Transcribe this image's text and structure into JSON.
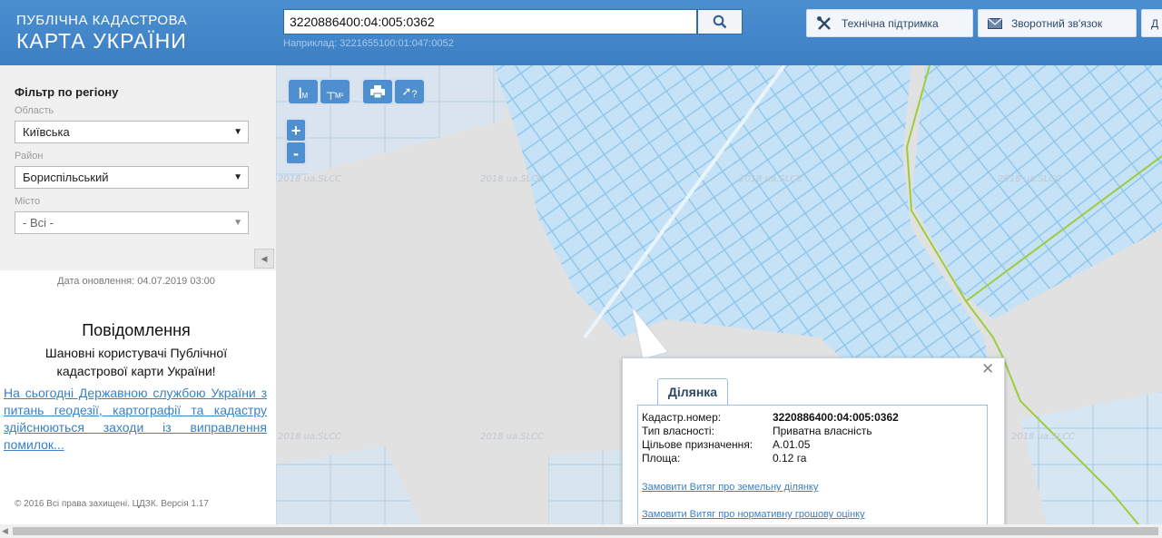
{
  "header": {
    "brand_line1": "ПУБЛІЧНА КАДАСТРОВА",
    "brand_line2": "КАРТА УКРАЇНИ",
    "search_value": "3220886400:04:005:0362",
    "search_example": "Наприклад: 3221655100:01:047:0052",
    "support_label": "Технічна підтримка",
    "feedback_label": "Зворотний зв'язок",
    "extra_label": "Д"
  },
  "sidebar": {
    "filter_title": "Фільтр по регіону",
    "region_label": "Область",
    "region_value": "Київська",
    "district_label": "Район",
    "district_value": "Бориспільський",
    "city_label": "Місто",
    "city_value": "- Всі -",
    "update_date": "Дата оновлення: 04.07.2019 03:00",
    "notice_title": "Повідомлення",
    "notice_greeting": "Шановні користувачі Публічної кадастрової карти України!",
    "notice_link": "На сьогодні Державною службою України з питань геодезії, картографії та кадастру здійснюються заходи із виправлення помилок...",
    "copyright": "© 2016 Всі права захищені. ЦДЗК. Версія 1.17"
  },
  "map": {
    "watermark": "2018 ua.SLCC",
    "tools": {
      "measure_distance": "М",
      "measure_area": "М²",
      "print": "print-icon",
      "identify": "?"
    },
    "zoom_in": "+",
    "zoom_out": "-"
  },
  "popup": {
    "tab_label": "Ділянка",
    "rows": [
      {
        "key": "Кадастр.номер:",
        "value": "3220886400:04:005:0362"
      },
      {
        "key": "Тип власності:",
        "value": "Приватна власність"
      },
      {
        "key": "Цільове призначення:",
        "value": "A.01.05"
      },
      {
        "key": "Площа:",
        "value": "0.12 га"
      }
    ],
    "link_extract": "Замовити Витяг про земельну ділянку",
    "link_valuation": "Замовити Витяг про нормативну грошову оцінку"
  },
  "colors": {
    "header_blue": "#3f84c8",
    "parcel_fill": "#c5e2f7",
    "parcel_stroke": "#8cc4ea",
    "boundary_green": "#9ccd3c",
    "link_blue": "#3a80c4"
  }
}
